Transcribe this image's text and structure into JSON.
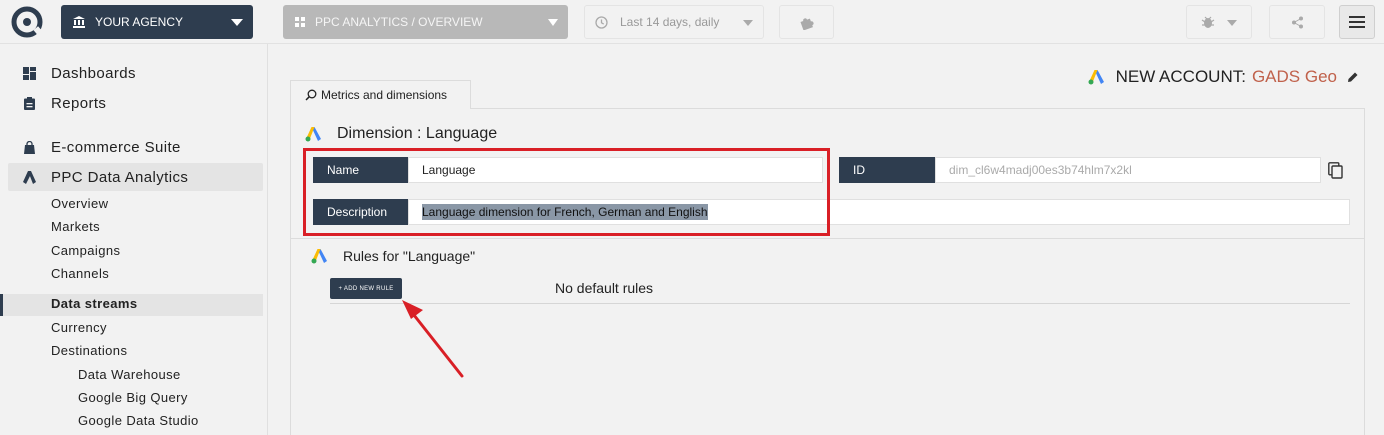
{
  "topbar": {
    "agency_label": "YOUR AGENCY",
    "project_label": "PPC ANALYTICS / OVERVIEW",
    "date_label": "Last 14 days, daily"
  },
  "sidebar": {
    "items": [
      {
        "label": "Dashboards",
        "icon": "dashboard-icon"
      },
      {
        "label": "Reports",
        "icon": "clipboard-icon"
      },
      {
        "label": "E-commerce Suite",
        "icon": "shopping-bag-icon"
      },
      {
        "label": "PPC Data Analytics",
        "icon": "google-ads-icon"
      }
    ],
    "ppc_sub": [
      "Overview",
      "Markets",
      "Campaigns",
      "Channels"
    ],
    "data_sub": [
      "Data streams",
      "Currency",
      "Destinations"
    ],
    "destinations": [
      "Data Warehouse",
      "Google Big Query",
      "Google Data Studio"
    ]
  },
  "account": {
    "prefix": "NEW ACCOUNT:",
    "name": "GADS Geo"
  },
  "tab": {
    "label": "Metrics and dimensions"
  },
  "dimension": {
    "title": "Dimension : Language",
    "name_label": "Name",
    "name_value": "Language",
    "id_label": "ID",
    "id_value": "dim_cl6w4madj00es3b74hlm7x2kl",
    "description_label": "Description",
    "description_value": "Language dimension for French, German and English"
  },
  "rules": {
    "title": "Rules for \"Language\"",
    "add_button": "+ ADD NEW RULE",
    "empty_text": "No default rules"
  },
  "colors": {
    "navy": "#2e3d4f",
    "accent_red": "#d91f26",
    "account_name": "#c0614b"
  }
}
